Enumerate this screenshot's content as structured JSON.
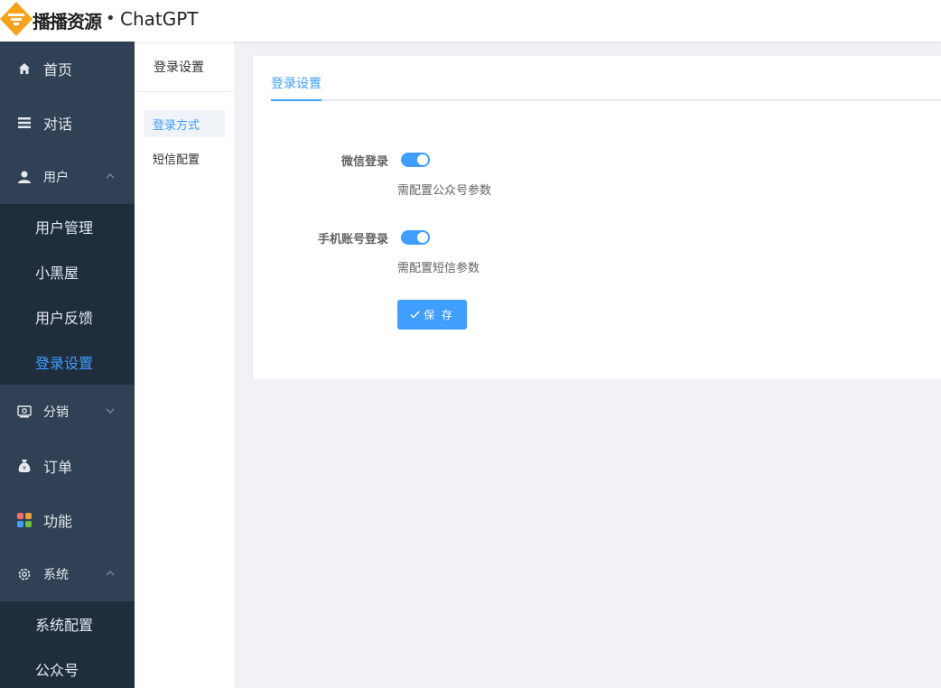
{
  "header": {
    "brand": "播播资源",
    "brand_dot": "•",
    "app_name": "ChatGPT"
  },
  "sidebar": {
    "items": [
      {
        "label": "首页",
        "icon": "home-icon"
      },
      {
        "label": "对话",
        "icon": "list-icon"
      },
      {
        "label": "用户",
        "icon": "user-icon",
        "expanded": true,
        "children": [
          "用户管理",
          "小黑屋",
          "用户反馈",
          "登录设置"
        ]
      },
      {
        "label": "分销",
        "icon": "distribution-icon",
        "expanded": false
      },
      {
        "label": "订单",
        "icon": "money-bag-icon"
      },
      {
        "label": "功能",
        "icon": "apps-icon"
      },
      {
        "label": "系统",
        "icon": "gear-icon",
        "expanded": true,
        "children": [
          "系统配置",
          "公众号"
        ]
      }
    ],
    "active_child": "登录设置"
  },
  "subnav": {
    "title": "登录设置",
    "items": [
      {
        "label": "登录方式",
        "active": true
      },
      {
        "label": "短信配置",
        "active": false
      }
    ]
  },
  "main": {
    "tab": "登录设置",
    "fields": [
      {
        "label": "微信登录",
        "enabled": true,
        "help": "需配置公众号参数"
      },
      {
        "label": "手机账号登录",
        "enabled": true,
        "help": "需配置短信参数"
      }
    ],
    "save_label": "保 存"
  },
  "colors": {
    "accent": "#409eff",
    "sidebar_bg": "#304156",
    "submenu_bg": "#1f2d3d",
    "logo": "#f7a21b"
  }
}
